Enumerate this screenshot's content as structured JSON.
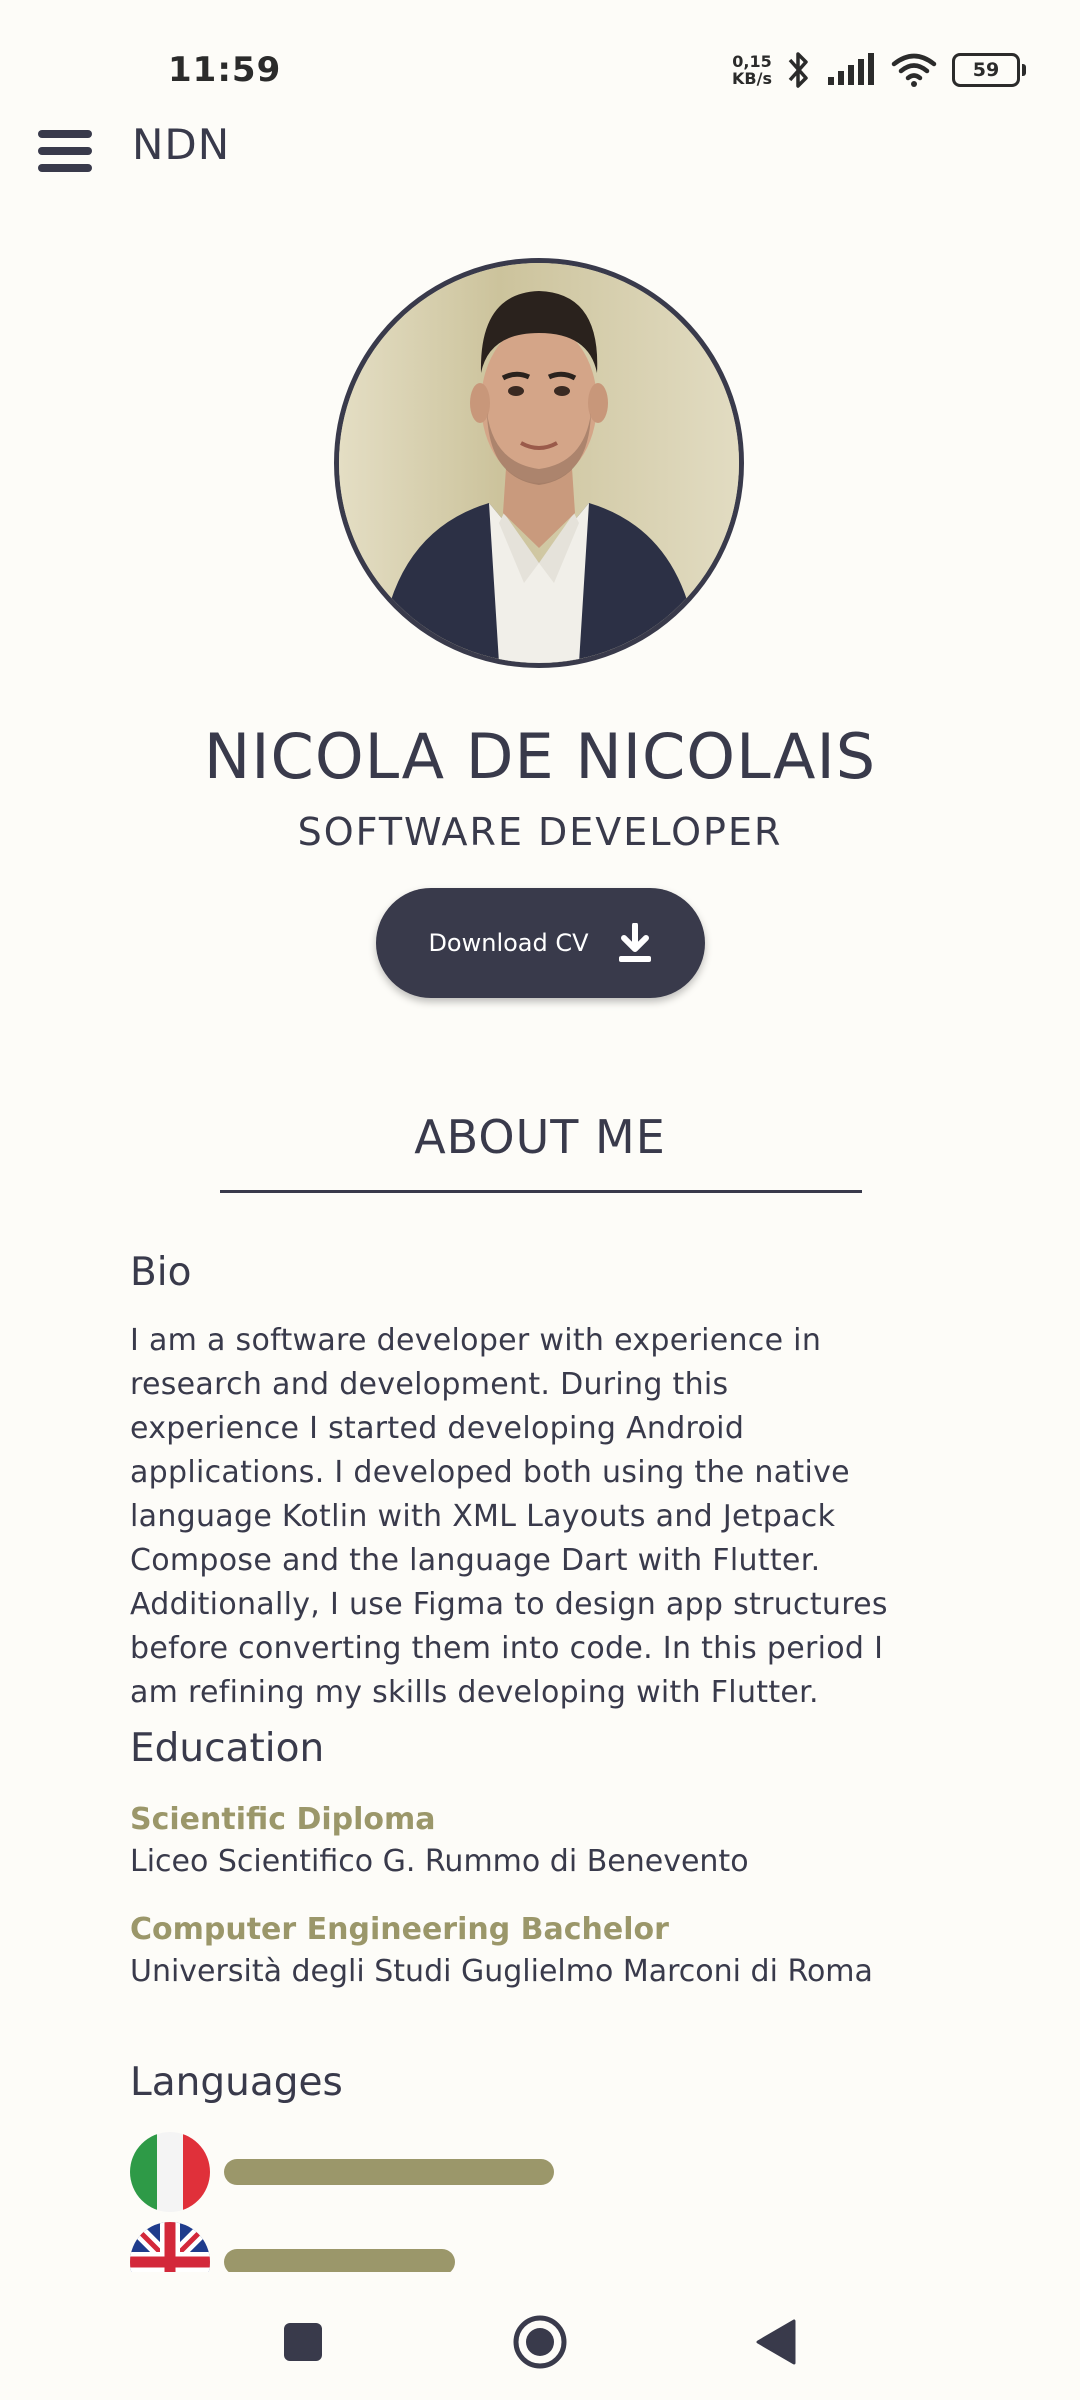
{
  "status_bar": {
    "time": "11:59",
    "net_speed_value": "0,15",
    "net_speed_unit": "KB/s",
    "battery": "59"
  },
  "app_bar": {
    "title": "NDN",
    "menu_icon": "hamburger-menu-icon"
  },
  "profile": {
    "name": "NICOLA DE NICOLAIS",
    "role": "SOFTWARE DEVELOPER",
    "download_label": "Download CV",
    "download_icon": "download-icon"
  },
  "about": {
    "title": "ABOUT ME",
    "bio_heading": "Bio",
    "bio_lines": [
      "I am a software developer with experience in",
      "research and development. During this",
      "experience I started developing Android",
      "applications. I developed both using the native",
      "language Kotlin with XML Layouts and Jetpack",
      "Compose and the language Dart with Flutter.",
      "Additionally, I use Figma to design app structures",
      "before converting them into code. In this period I",
      "am refining my skills developing with Flutter."
    ]
  },
  "education": {
    "heading": "Education",
    "items": [
      {
        "title": "Scientific Diploma",
        "school": "Liceo Scientifico G. Rummo di Benevento"
      },
      {
        "title": "Computer Engineering Bachelor",
        "school": "Università degli Studi Guglielmo Marconi di Roma"
      }
    ]
  },
  "languages": {
    "heading": "Languages",
    "items": [
      {
        "flag": "italy-flag-icon",
        "level": 1.0
      },
      {
        "flag": "uk-flag-icon",
        "level": 0.7
      }
    ]
  },
  "nav": {
    "recents": "square-recents-icon",
    "home": "circle-home-icon",
    "back": "triangle-back-icon"
  },
  "colors": {
    "primary": "#393a4b",
    "accent": "#9b976a",
    "background": "#fdfcf8"
  }
}
